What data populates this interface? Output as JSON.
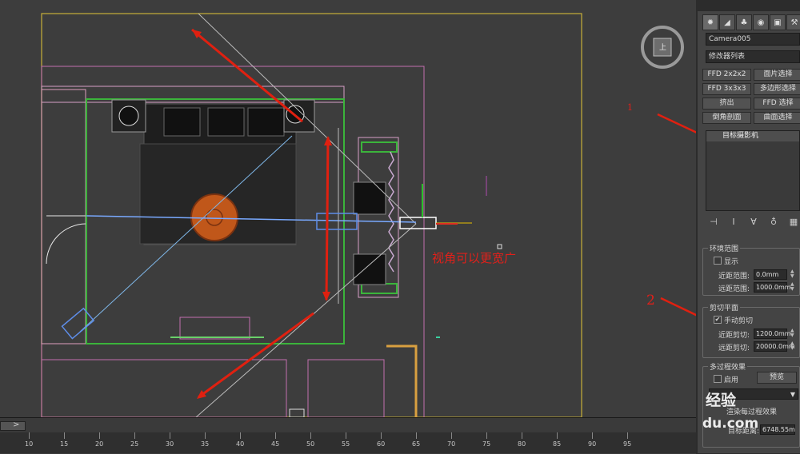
{
  "viewport": {
    "annotation_text": "视角可以更宽广",
    "marker_1": "1",
    "marker_2": "2",
    "navcube_label": "上"
  },
  "timeline": {
    "arrow": ">",
    "ticks": [
      "10",
      "15",
      "20",
      "25",
      "30",
      "35",
      "40",
      "45",
      "50",
      "55",
      "60",
      "65",
      "70",
      "75",
      "80",
      "85",
      "90",
      "95"
    ]
  },
  "panel": {
    "tabs": [
      "create-icon",
      "modify-icon",
      "hierarchy-icon",
      "motion-icon",
      "display-icon",
      "utilities-icon"
    ],
    "object_name": "Camera005",
    "modifier_list": "修改器列表",
    "buttons": [
      [
        "FFD 2x2x2",
        "面片选择"
      ],
      [
        "FFD 3x3x3",
        "多边形选择"
      ],
      [
        "挤出",
        "FFD 选择"
      ],
      [
        "倒角剖面",
        "曲面选择"
      ]
    ],
    "stack_item": "目标摄影机",
    "env_range": {
      "title": "环境范围",
      "show_label": "显示",
      "near_label": "近距范围:",
      "near_value": "0.0mm",
      "far_label": "远距范围:",
      "far_value": "1000.0mm"
    },
    "clip": {
      "title": "剪切平面",
      "manual_label": "手动剪切",
      "manual_checked": "✔",
      "near_label": "近距剪切:",
      "near_value": "1200.0mm",
      "far_label": "远距剪切:",
      "far_value": "20000.0mm"
    },
    "multipass": {
      "title": "多过程效果",
      "enable_label": "启用",
      "preview_label": "预览",
      "render_label": "渲染每过程效果",
      "target_label": "目标距离:",
      "target_value": "6748.55m"
    }
  },
  "watermark": {
    "line1": "经验",
    "line2": "du.com"
  }
}
